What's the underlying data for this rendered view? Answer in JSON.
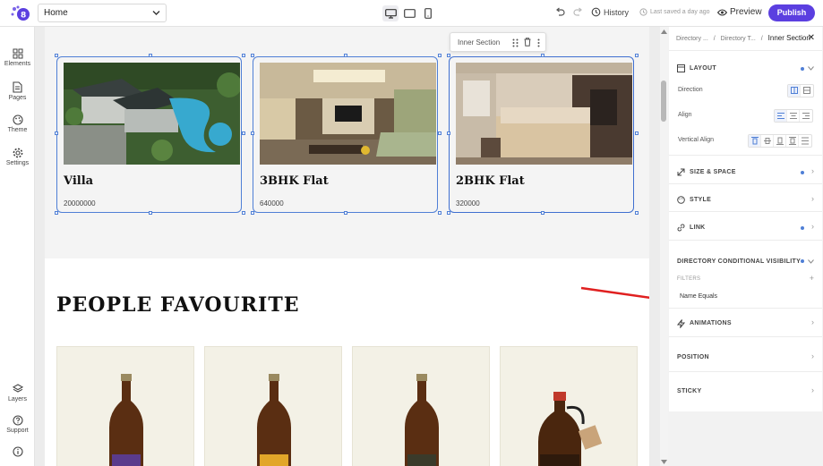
{
  "topbar": {
    "page_name": "Home",
    "history_label": "History",
    "saved_text": "Last saved a day ago",
    "preview_label": "Preview",
    "publish_label": "Publish",
    "accent_color": "#5b3fe0"
  },
  "leftbar": {
    "elements": "Elements",
    "pages": "Pages",
    "theme": "Theme",
    "settings": "Settings",
    "layers": "Layers",
    "support": "Support"
  },
  "canvas": {
    "inner_section_label": "Inner Section",
    "cards": [
      {
        "title": "Villa",
        "price": "20000000"
      },
      {
        "title": "3BHK Flat",
        "price": "640000"
      },
      {
        "title": "2BHK Flat",
        "price": "320000"
      }
    ],
    "section_title": "PEOPLE FAVOURITE"
  },
  "right_panel": {
    "breadcrumb": [
      "Directory ...",
      "Directory T...",
      "Inner Section"
    ],
    "layout": "LAYOUT",
    "direction": "Direction",
    "align": "Align",
    "vertical_align": "Vertical Align",
    "size_space": "SIZE & SPACE",
    "style": "STYLE",
    "link": "LINK",
    "directory_visibility": "DIRECTORY CONDITIONAL VISIBILITY",
    "filters": "FILTERS",
    "filter_item": "Name Equals",
    "animations": "ANIMATIONS",
    "position": "POSITION",
    "sticky": "STICKY",
    "dot_color": "#4f7fd6"
  }
}
